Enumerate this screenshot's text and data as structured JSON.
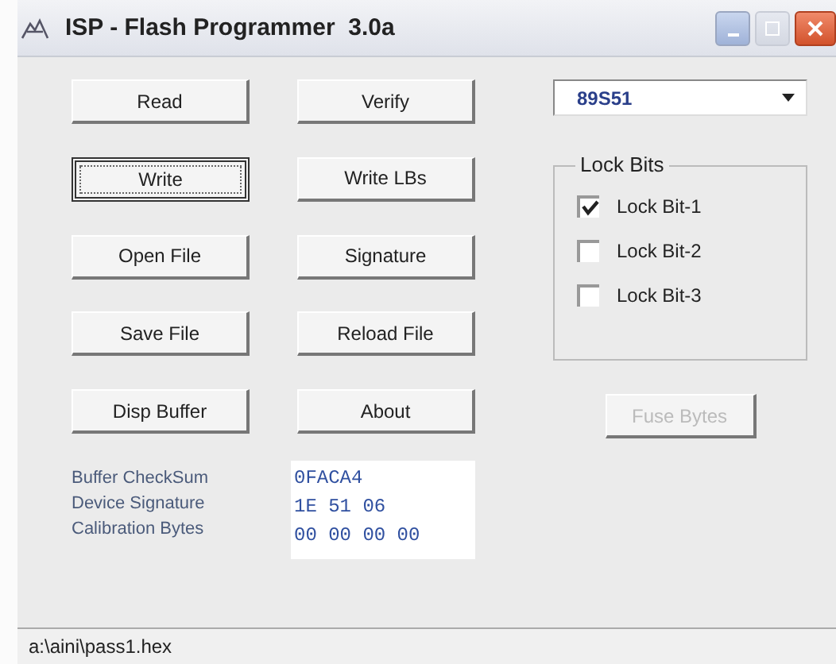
{
  "window": {
    "title": "ISP - Flash Programmer  3.0a"
  },
  "buttons": [
    {
      "label": "Read",
      "default": false
    },
    {
      "label": "Verify",
      "default": false
    },
    {
      "label": "Write",
      "default": true
    },
    {
      "label": "Write LBs",
      "default": false
    },
    {
      "label": "Open File",
      "default": false
    },
    {
      "label": "Signature",
      "default": false
    },
    {
      "label": "Save File",
      "default": false
    },
    {
      "label": "Reload File",
      "default": false
    },
    {
      "label": "Disp Buffer",
      "default": false
    },
    {
      "label": "About",
      "default": false
    }
  ],
  "device_select": {
    "value": "89S51"
  },
  "lock_bits": {
    "title": "Lock Bits",
    "items": [
      {
        "label": "Lock Bit-1",
        "checked": true
      },
      {
        "label": "Lock Bit-2",
        "checked": false
      },
      {
        "label": "Lock Bit-3",
        "checked": false
      }
    ]
  },
  "fuse_button": {
    "label": "Fuse Bytes",
    "disabled": true
  },
  "info": [
    {
      "label": "Buffer CheckSum",
      "value": "0FACA4"
    },
    {
      "label": "Device Signature",
      "value": "1E 51 06"
    },
    {
      "label": "Calibration Bytes",
      "value": "00 00 00 00"
    }
  ],
  "status_bar": {
    "text": "a:\\aini\\pass1.hex"
  }
}
